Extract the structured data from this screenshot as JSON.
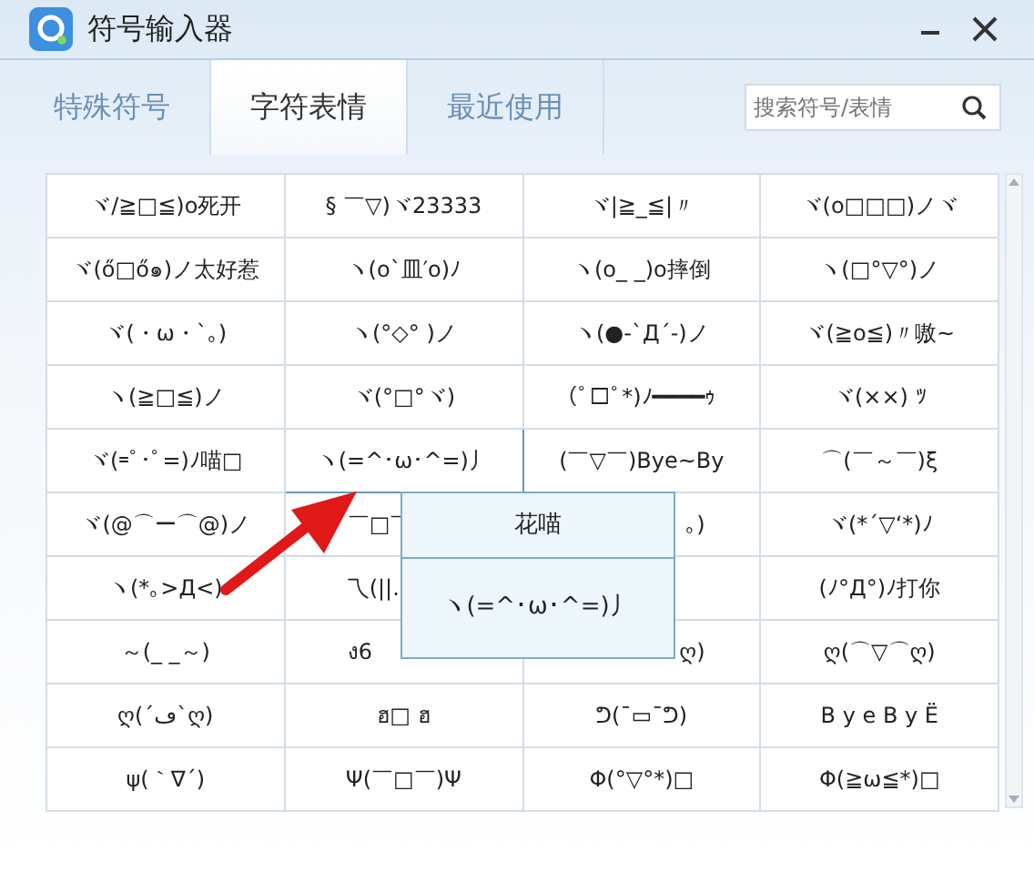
{
  "window": {
    "title": "符号输入器"
  },
  "tabs": [
    {
      "label": "特殊符号",
      "selected": false
    },
    {
      "label": "字符表情",
      "selected": true
    },
    {
      "label": "最近使用",
      "selected": false
    }
  ],
  "search": {
    "placeholder": "搜索符号/表情"
  },
  "grid": [
    [
      {
        "text": "ヾ/≧□≦)o死开",
        "selected": false
      },
      {
        "text": "§ ￣▽)ヾ23333",
        "selected": false
      },
      {
        "text": "ヾ|≧_≦|〃",
        "selected": false
      },
      {
        "text": "ヾ(o□□□)ノヾ",
        "selected": false
      }
    ],
    [
      {
        "text": "ヾ(ő□ő๑)ノ太好惹",
        "selected": false
      },
      {
        "text": "ヽ(o`皿′o)ﾉ",
        "selected": false
      },
      {
        "text": "ヽ(o_ _)o摔倒",
        "selected": false
      },
      {
        "text": "ヽ(□°▽°)ノ",
        "selected": false
      }
    ],
    [
      {
        "text": "ヾ(・ω・`｡)",
        "selected": false
      },
      {
        "text": "ヽ(°◇° )ノ",
        "selected": false
      },
      {
        "text": "ヽ(●-`Д´-)ノ",
        "selected": false
      },
      {
        "text": "ヾ(≧o≦)〃嗷~",
        "selected": false
      }
    ],
    [
      {
        "text": "ヽ(≧□≦)ノ",
        "selected": false
      },
      {
        "text": "ヾ(°□°ヾ)",
        "selected": false
      },
      {
        "text": "(ﾟ□ﾟ*)ﾉ━━━━ｩ",
        "selected": false
      },
      {
        "text": "ヾ(××) ﾂ",
        "selected": false
      }
    ],
    [
      {
        "text": "ヾ(=ﾟ･ﾟ=)ﾉ喵□",
        "selected": false
      },
      {
        "text": "ヽ(=^･ω･^=)丿",
        "selected": true
      },
      {
        "text": "(￣▽￣)Bye~By",
        "selected": false
      },
      {
        "text": "⌒(￣～￣)ξ",
        "selected": false
      }
    ],
    [
      {
        "text": "ヾ(@⌒ー⌒@)ノ",
        "selected": false
      },
      {
        "text": "￣□￣",
        "selected": false,
        "kind": "cut_right"
      },
      {
        "text": "｡)",
        "selected": false,
        "kind": "cut_left"
      },
      {
        "text": "ヾ(*´▽‘*)ﾉ",
        "selected": false
      }
    ],
    [
      {
        "text": "ヽ(*｡>Д<)",
        "selected": false
      },
      {
        "text": "乁(||.",
        "selected": false,
        "kind": "cut_right"
      },
      {
        "kind": "hidden"
      },
      {
        "text": "(ﾉ°Д°)ﾉ打你",
        "selected": false
      }
    ],
    [
      {
        "text": "～(_ _～)",
        "selected": false
      },
      {
        "text": "ง6",
        "selected": false,
        "kind": "cut_right"
      },
      {
        "text": "ღ)",
        "selected": false,
        "kind": "cut_left"
      },
      {
        "text": "ღ(⌒▽⌒ღ)",
        "selected": false
      }
    ],
    [
      {
        "text": "ღ(´ڡ`ღ)",
        "selected": false
      },
      {
        "text": "ฮ□ ฮ",
        "selected": false
      },
      {
        "text": "ᕤ(¯▭¯ᕤ)",
        "selected": false
      },
      {
        "text": "B y e  B y Ë",
        "selected": false
      }
    ],
    [
      {
        "text": "ψ(｀∇´)",
        "selected": false
      },
      {
        "text": "Ψ(￣□￣)Ψ",
        "selected": false
      },
      {
        "text": "Φ(°▽°*)□",
        "selected": false
      },
      {
        "text": "Φ(≧ω≦*)□",
        "selected": false
      }
    ]
  ],
  "tooltip": {
    "title": "花喵",
    "text": "ヽ(=^･ω･^=)丿"
  }
}
